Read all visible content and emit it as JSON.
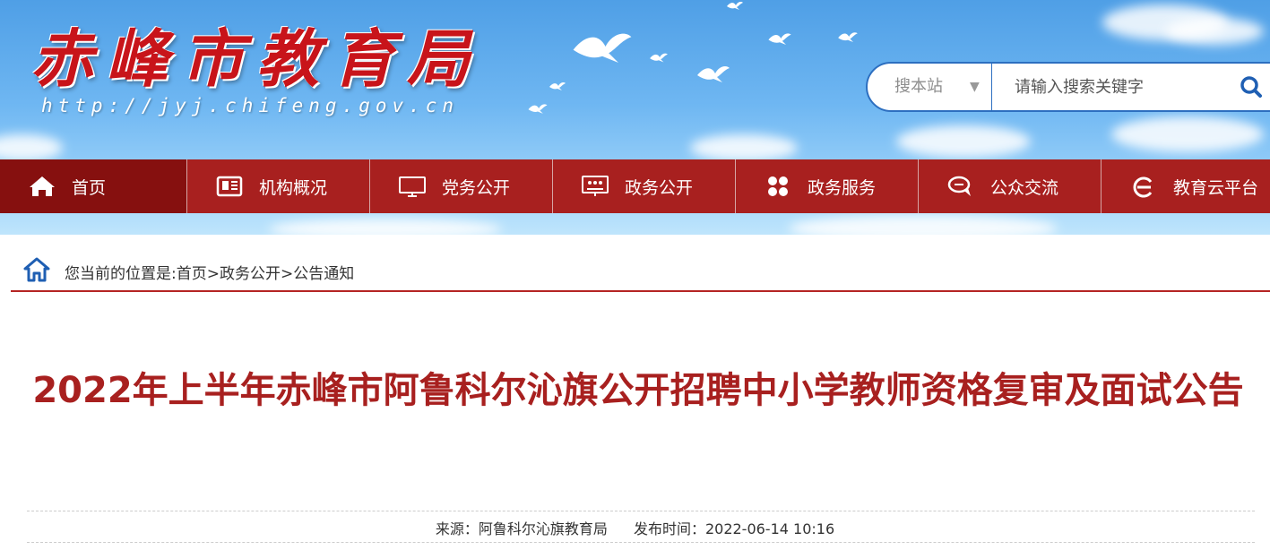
{
  "header": {
    "logo_text": "赤峰市教育局",
    "logo_url": "http://jyj.chifeng.gov.cn"
  },
  "search": {
    "scope_label": "搜本站",
    "placeholder": "请输入搜索关键字"
  },
  "nav": {
    "items": [
      {
        "label": "首页",
        "icon": "home-icon"
      },
      {
        "label": "机构概况",
        "icon": "newspaper-icon"
      },
      {
        "label": "党务公开",
        "icon": "monitor-icon"
      },
      {
        "label": "政务公开",
        "icon": "presentation-icon"
      },
      {
        "label": "政务服务",
        "icon": "grid-icon"
      },
      {
        "label": "公众交流",
        "icon": "chat-icon"
      },
      {
        "label": "教育云平台",
        "icon": "cloud-e-icon"
      }
    ]
  },
  "breadcrumb": {
    "text": "您当前的位置是:首页>政务公开>公告通知"
  },
  "article": {
    "title": "2022年上半年赤峰市阿鲁科尔沁旗公开招聘中小学教师资格复审及面试公告",
    "source": "来源：阿鲁科尔沁旗教育局",
    "published": "发布时间：2022-06-14 10:16"
  },
  "colors": {
    "nav_bg": "#a8201f",
    "nav_active_bg": "#86100f",
    "title": "#a8201f",
    "search_border": "#2d6fc0"
  }
}
